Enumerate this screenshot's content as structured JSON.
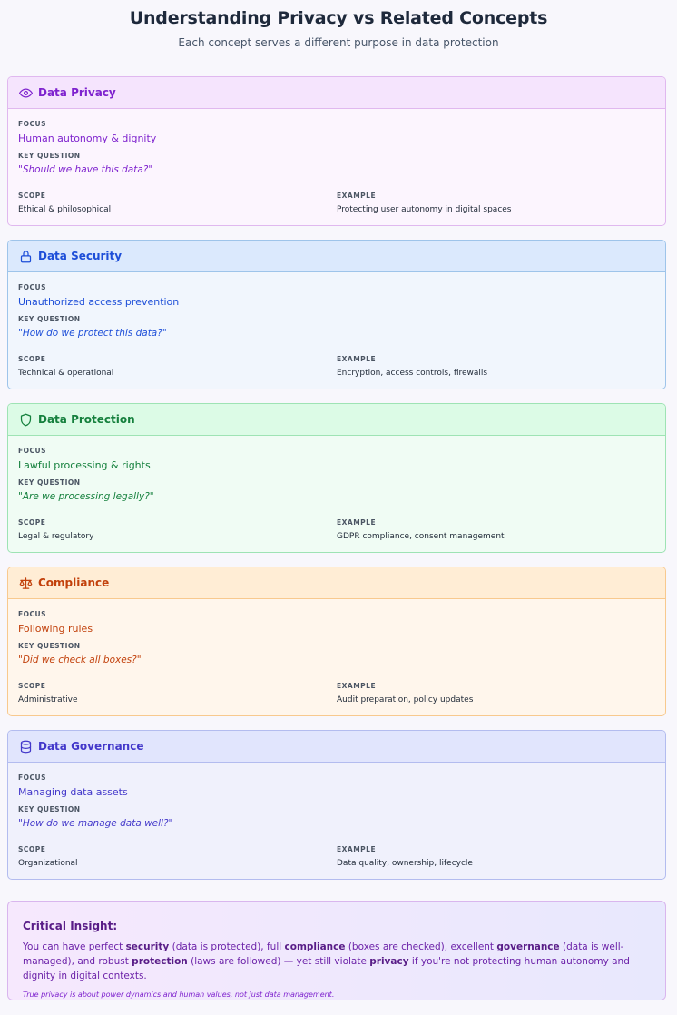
{
  "header": {
    "title": "Understanding Privacy vs Related Concepts",
    "subtitle": "Each concept serves a different purpose in data protection"
  },
  "labels": {
    "focus": "FOCUS",
    "key_question": "KEY QUESTION",
    "scope": "SCOPE",
    "example": "EXAMPLE"
  },
  "cards": [
    {
      "icon": "eye-icon",
      "title": "Data Privacy",
      "focus": "Human autonomy & dignity",
      "question": "\"Should we have this data?\"",
      "scope": "Ethical & philosophical",
      "example": "Protecting user autonomy in digital spaces",
      "color": "#7e22ce"
    },
    {
      "icon": "lock-icon",
      "title": "Data Security",
      "focus": "Unauthorized access prevention",
      "question": "\"How do we protect this data?\"",
      "scope": "Technical & operational",
      "example": "Encryption, access controls, firewalls",
      "color": "#1d4ed8"
    },
    {
      "icon": "shield-icon",
      "title": "Data Protection",
      "focus": "Lawful processing & rights",
      "question": "\"Are we processing legally?\"",
      "scope": "Legal & regulatory",
      "example": "GDPR compliance, consent management",
      "color": "#15803d"
    },
    {
      "icon": "scale-icon",
      "title": "Compliance",
      "focus": "Following rules",
      "question": "\"Did we check all boxes?\"",
      "scope": "Administrative",
      "example": "Audit preparation, policy updates",
      "color": "#c2410c"
    },
    {
      "icon": "database-icon",
      "title": "Data Governance",
      "focus": "Managing data assets",
      "question": "\"How do we manage data well?\"",
      "scope": "Organizational",
      "example": "Data quality, ownership, lifecycle",
      "color": "#4338ca"
    }
  ],
  "insight": {
    "title": "Critical Insight:",
    "t1": "You can have perfect ",
    "b1": "security",
    "t2": " (data is protected), full ",
    "b2": "compliance",
    "t3": " (boxes are checked), excellent ",
    "b3": "governance",
    "t4": " (data is well-managed), and robust ",
    "b4": "protection",
    "t5": " (laws are followed) — yet still violate ",
    "b5": "privacy",
    "t6": " if you're not protecting human autonomy and dignity in digital contexts.",
    "note": "True privacy is about power dynamics and human values, not just data management."
  }
}
